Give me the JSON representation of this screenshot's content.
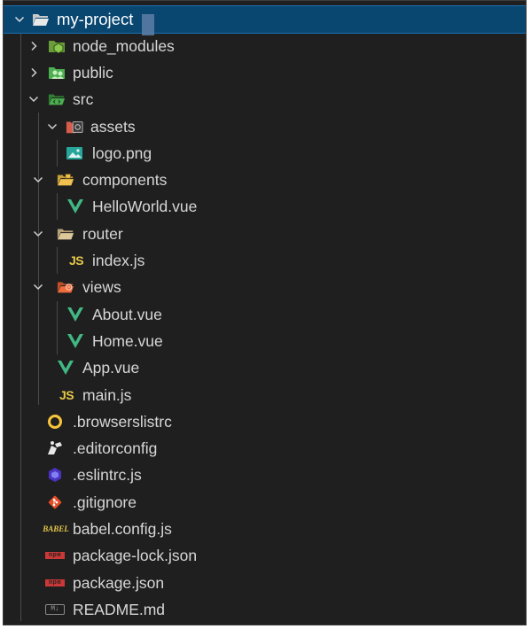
{
  "explorer": {
    "root": {
      "label": "my-project",
      "expanded": true
    },
    "items": [
      {
        "label": "node_modules",
        "icon": "node-folder-icon",
        "kind": "folder",
        "expanded": false
      },
      {
        "label": "public",
        "icon": "public-folder-icon",
        "kind": "folder",
        "expanded": false
      },
      {
        "label": "src",
        "icon": "src-folder-icon",
        "kind": "folder",
        "expanded": true
      },
      {
        "label": "assets",
        "icon": "assets-folder-icon",
        "kind": "folder",
        "expanded": true
      },
      {
        "label": "logo.png",
        "icon": "image-file-icon",
        "kind": "file"
      },
      {
        "label": "components",
        "icon": "components-folder-icon",
        "kind": "folder",
        "expanded": true
      },
      {
        "label": "HelloWorld.vue",
        "icon": "vue-file-icon",
        "kind": "file"
      },
      {
        "label": "router",
        "icon": "folder-icon",
        "kind": "folder",
        "expanded": true
      },
      {
        "label": "index.js",
        "icon": "js-file-icon",
        "kind": "file"
      },
      {
        "label": "views",
        "icon": "views-folder-icon",
        "kind": "folder",
        "expanded": true
      },
      {
        "label": "About.vue",
        "icon": "vue-file-icon",
        "kind": "file"
      },
      {
        "label": "Home.vue",
        "icon": "vue-file-icon",
        "kind": "file"
      },
      {
        "label": "App.vue",
        "icon": "vue-file-icon",
        "kind": "file"
      },
      {
        "label": "main.js",
        "icon": "js-file-icon",
        "kind": "file"
      },
      {
        "label": ".browserslistrc",
        "icon": "browserslist-icon",
        "kind": "file"
      },
      {
        "label": ".editorconfig",
        "icon": "editorconfig-icon",
        "kind": "file"
      },
      {
        "label": ".eslintrc.js",
        "icon": "eslint-icon",
        "kind": "file"
      },
      {
        "label": ".gitignore",
        "icon": "git-icon",
        "kind": "file"
      },
      {
        "label": "babel.config.js",
        "icon": "babel-icon",
        "kind": "file"
      },
      {
        "label": "package-lock.json",
        "icon": "npm-icon",
        "kind": "file"
      },
      {
        "label": "package.json",
        "icon": "npm-icon",
        "kind": "file"
      },
      {
        "label": "README.md",
        "icon": "markdown-icon",
        "kind": "file"
      }
    ],
    "icon_glyphs": {
      "js": "JS",
      "babel": "BABEL",
      "npm": "npm",
      "markdown": "M↓"
    },
    "colors": {
      "background": "#1f1f1f",
      "selected_row": "#094771",
      "text": "#d7d7d7",
      "vue_green": "#41b883",
      "js_yellow": "#e6c84a",
      "npm_red": "#cb3837",
      "git_orange": "#e44d26",
      "eslint_purple": "#4b32c3"
    }
  }
}
